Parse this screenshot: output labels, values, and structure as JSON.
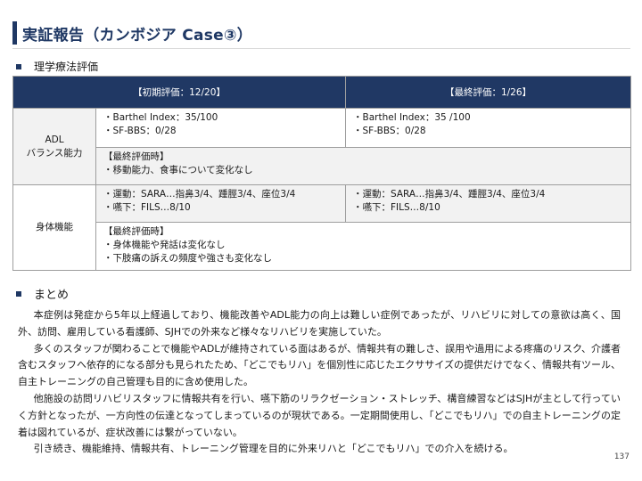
{
  "title": "実証報告（カンボジア Case③）",
  "section1_label": "理学療法評価",
  "table": {
    "headers": [
      "【初期評価：12/20】",
      "【最終評価：1/26】"
    ],
    "rows": [
      {
        "label_lines": [
          "ADL",
          "バランス能力"
        ],
        "initial": [
          "・Barthel Index：35/100",
          "・SF-BBS：0/28"
        ],
        "final": [
          "・Barthel Index：35 /100",
          "・SF-BBS：0/28"
        ],
        "note": [
          "【最終評価時】",
          "・移動能力、食事について変化なし"
        ]
      },
      {
        "label_lines": [
          "身体機能"
        ],
        "initial": [
          "・運動：SARA…指鼻3/4、踵脛3/4、座位3/4",
          "・嚥下：FILS…8/10"
        ],
        "final": [
          "・運動：SARA…指鼻3/4、踵脛3/4、座位3/4",
          "・嚥下：FILS…8/10"
        ],
        "note": [
          "【最終評価時】",
          "・身体機能や発話は変化なし",
          "・下肢痛の訴えの頻度や強さも変化なし"
        ]
      }
    ]
  },
  "section2_label": "まとめ",
  "summary": [
    "本症例は発症から5年以上経過しており、機能改善やADL能力の向上は難しい症例であったが、リハビリに対しての意欲は高く、国外、訪問、雇用している看護師、SJHでの外来など様々なリハビリを実施していた。",
    "多くのスタッフが関わることで機能やADLが維持されている面はあるが、情報共有の難しさ、誤用や過用による疼痛のリスク、介護者含むスタッフへ依存的になる部分も見られたため、「どこでもリハ」を個別性に応じたエクササイズの提供だけでなく、情報共有ツール、自主トレーニングの自己管理も目的に含め使用した。",
    "他施設の訪問リハビリスタッフに情報共有を行い、嚥下筋のリラクゼーション・ストレッチ、構音練習などはSJHが主として行っていく方針となったが、一方向性の伝達となってしまっているのが現状である。一定期間使用し、「どこでもリハ」での自主トレーニングの定着は図れているが、症状改善には繋がっていない。",
    "引き続き、機能維持、情報共有、トレーニング管理を目的に外来リハと「どこでもリハ」での介入を続ける。"
  ],
  "page_number": "137",
  "colors": {
    "accent": "#1f3864",
    "header_bg": "#203864",
    "shade": "#f2f2f2"
  }
}
